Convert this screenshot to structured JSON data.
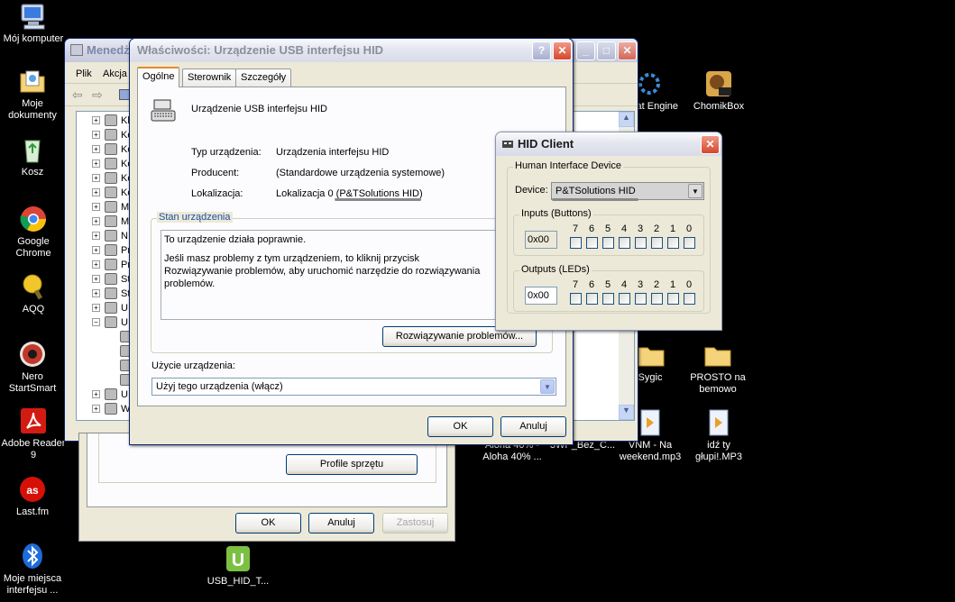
{
  "desktop": {
    "left_icons": [
      {
        "label": "Mój komputer"
      },
      {
        "label": "Moje\ndokumenty"
      },
      {
        "label": "Kosz"
      },
      {
        "label": "Google\nChrome"
      },
      {
        "label": "AQQ"
      },
      {
        "label": "Nero\nStartSmart"
      },
      {
        "label": "Adobe Reader\n9"
      },
      {
        "label": "Last.fm"
      },
      {
        "label": "Moje miejsca\ninterfejsu ..."
      }
    ],
    "right_icons": [
      {
        "label": "at Engine"
      },
      {
        "label": "ChomikBox"
      },
      {
        "label": "Sygic"
      },
      {
        "label": "PROSTO na\nbemowo"
      },
      {
        "label": "Aloha 40% -\nAloha 40% ..."
      },
      {
        "label": "3WP_Bez_C..."
      },
      {
        "label": "VNM - Na\nweekend.mp3"
      },
      {
        "label": "idź ty\ngłupi!.MP3"
      }
    ],
    "bottom_icon": {
      "label": "USB_HID_T..."
    }
  },
  "device_manager": {
    "title": "Menedż",
    "menu": [
      "Plik",
      "Akcja"
    ],
    "profile_button": "Profile sprzętu",
    "ok": "OK",
    "cancel": "Anuluj",
    "apply": "Zastosuj",
    "tree_items": [
      "Kl",
      "Ko",
      "Ko",
      "Ko",
      "Ko",
      "Ko",
      "M",
      "M",
      "N",
      "Pr",
      "Pr",
      "St",
      "St",
      "U",
      "U",
      "",
      "",
      "",
      "",
      "U",
      "W"
    ]
  },
  "properties": {
    "title": "Właściwości: Urządzenie USB interfejsu HID",
    "tabs": [
      "Ogólne",
      "Sterownik",
      "Szczegóły"
    ],
    "device_name": "Urządzenie USB interfejsu HID",
    "rows": [
      {
        "label": "Typ urządzenia:",
        "value": "Urządzenia interfejsu HID"
      },
      {
        "label": "Producent:",
        "value": "(Standardowe urządzenia systemowe)"
      },
      {
        "label": "Lokalizacja:",
        "value": "Lokalizacja 0 (P&TSolutions  HID)"
      }
    ],
    "status_group": "Stan urządzenia",
    "status_text_1": "To urządzenie działa poprawnie.",
    "status_text_2": "Jeśli masz problemy z tym urządzeniem, to kliknij przycisk Rozwiązywanie problemów, aby uruchomić narzędzie do rozwiązywania problemów.",
    "troubleshoot_button": "Rozwiązywanie problemów...",
    "usage_label": "Użycie urządzenia:",
    "usage_value": "Użyj tego urządzenia (włącz)",
    "ok": "OK",
    "cancel": "Anuluj"
  },
  "hid_client": {
    "title": "HID Client",
    "group": "Human Interface Device",
    "device_label": "Device:",
    "device_value": "P&TSolutions  HID",
    "inputs_group": "Inputs (Buttons)",
    "inputs_value": "0x00",
    "outputs_group": "Outputs (LEDs)",
    "outputs_value": "0x00",
    "bits": [
      "7",
      "6",
      "5",
      "4",
      "3",
      "2",
      "1",
      "0"
    ]
  },
  "colors": {
    "desktop": "#000000",
    "xp_face": "#ece9d8",
    "xp_border": "#0a246a",
    "close_red": "#d6462c",
    "tab_orange": "#e68b2c"
  }
}
